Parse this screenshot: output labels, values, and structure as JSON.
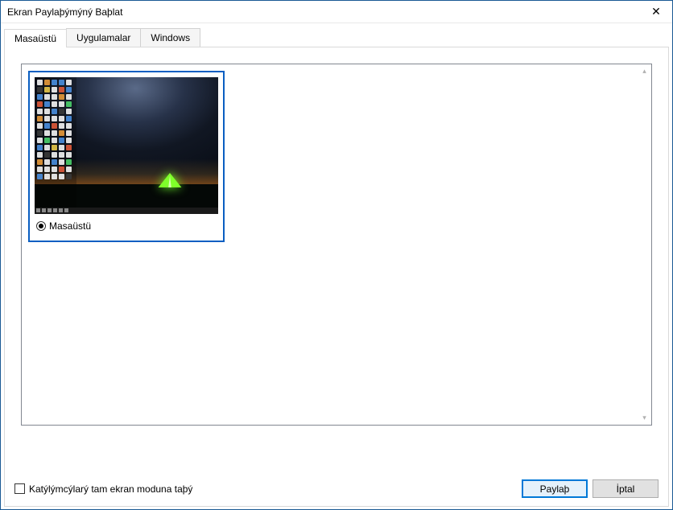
{
  "window": {
    "title": "Ekran Paylaþýmýný Baþlat"
  },
  "tabs": {
    "desktop": "Masaüstü",
    "apps": "Uygulamalar",
    "windows": "Windows"
  },
  "selection": {
    "item_label": "Masaüstü"
  },
  "footer": {
    "checkbox_label": "Katýlýmcýlarý tam ekran moduna taþý",
    "share_button": "Paylaþ",
    "cancel_button": "İptal"
  }
}
